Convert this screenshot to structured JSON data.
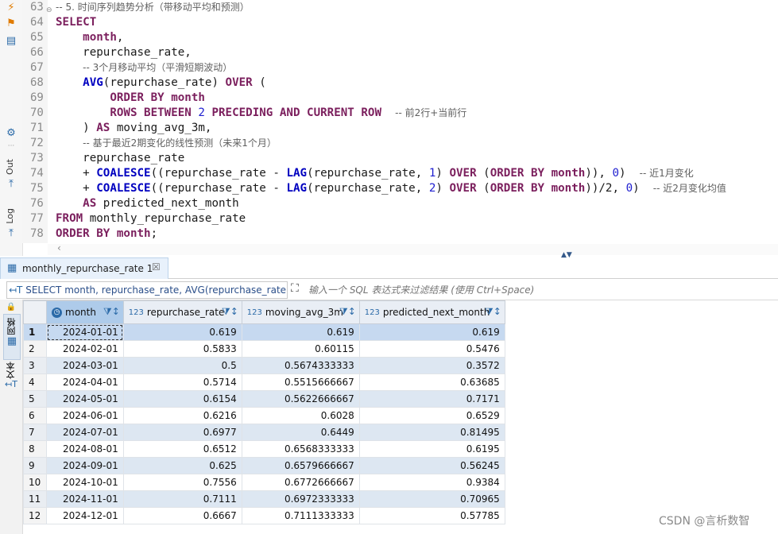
{
  "sidebar": {
    "out_label": "Out",
    "log_label": "Log",
    "grid_tab_label": "网格",
    "text_tab_label": "文本"
  },
  "editor": {
    "lines": [
      {
        "n": "63",
        "fold": "⊖",
        "tokens": [
          [
            "cm",
            "-- 5. 时间序列趋势分析（带移动平均和预测）"
          ]
        ]
      },
      {
        "n": "64",
        "tokens": [
          [
            "kw",
            "SELECT"
          ]
        ]
      },
      {
        "n": "65",
        "tokens": [
          [
            "tx",
            "    "
          ],
          [
            "kw",
            "month"
          ],
          [
            "tx",
            ","
          ]
        ]
      },
      {
        "n": "66",
        "tokens": [
          [
            "tx",
            "    repurchase_rate,"
          ]
        ]
      },
      {
        "n": "67",
        "tokens": [
          [
            "tx",
            "    "
          ],
          [
            "cm",
            "-- 3个月移动平均（平滑短期波动）"
          ]
        ]
      },
      {
        "n": "68",
        "tokens": [
          [
            "tx",
            "    "
          ],
          [
            "fn",
            "AVG"
          ],
          [
            "tx",
            "(repurchase_rate) "
          ],
          [
            "kw",
            "OVER"
          ],
          [
            "tx",
            " ("
          ]
        ]
      },
      {
        "n": "69",
        "tokens": [
          [
            "tx",
            "        "
          ],
          [
            "kw",
            "ORDER BY month"
          ]
        ]
      },
      {
        "n": "70",
        "tokens": [
          [
            "tx",
            "        "
          ],
          [
            "kw",
            "ROWS BETWEEN "
          ],
          [
            "num",
            "2"
          ],
          [
            "kw",
            " PRECEDING AND CURRENT ROW"
          ],
          [
            "tx",
            "  "
          ],
          [
            "cm",
            "-- 前2行+当前行"
          ]
        ]
      },
      {
        "n": "71",
        "tokens": [
          [
            "tx",
            "    ) "
          ],
          [
            "kw",
            "AS"
          ],
          [
            "tx",
            " moving_avg_3m,"
          ]
        ]
      },
      {
        "n": "72",
        "tokens": [
          [
            "tx",
            "    "
          ],
          [
            "cm",
            "-- 基于最近2期变化的线性预测（未来1个月）"
          ]
        ]
      },
      {
        "n": "73",
        "tokens": [
          [
            "tx",
            "    repurchase_rate"
          ]
        ]
      },
      {
        "n": "74",
        "tokens": [
          [
            "tx",
            "    + "
          ],
          [
            "fn",
            "COALESCE"
          ],
          [
            "tx",
            "((repurchase_rate - "
          ],
          [
            "fn",
            "LAG"
          ],
          [
            "tx",
            "(repurchase_rate, "
          ],
          [
            "num",
            "1"
          ],
          [
            "tx",
            ") "
          ],
          [
            "kw",
            "OVER"
          ],
          [
            "tx",
            " ("
          ],
          [
            "kw",
            "ORDER BY month"
          ],
          [
            "tx",
            ")), "
          ],
          [
            "num",
            "0"
          ],
          [
            "tx",
            ")  "
          ],
          [
            "cm",
            "-- 近1月变化"
          ]
        ]
      },
      {
        "n": "75",
        "tokens": [
          [
            "tx",
            "    + "
          ],
          [
            "fn",
            "COALESCE"
          ],
          [
            "tx",
            "((repurchase_rate - "
          ],
          [
            "fn",
            "LAG"
          ],
          [
            "tx",
            "(repurchase_rate, "
          ],
          [
            "num",
            "2"
          ],
          [
            "tx",
            ") "
          ],
          [
            "kw",
            "OVER"
          ],
          [
            "tx",
            " ("
          ],
          [
            "kw",
            "ORDER BY month"
          ],
          [
            "tx",
            "))/2, "
          ],
          [
            "num",
            "0"
          ],
          [
            "tx",
            ")  "
          ],
          [
            "cm",
            "-- 近2月变化均值"
          ]
        ]
      },
      {
        "n": "76",
        "tokens": [
          [
            "tx",
            "    "
          ],
          [
            "kw",
            "AS"
          ],
          [
            "tx",
            " predicted_next_month"
          ]
        ]
      },
      {
        "n": "77",
        "tokens": [
          [
            "kw",
            "FROM"
          ],
          [
            "tx",
            " monthly_repurchase_rate"
          ]
        ]
      },
      {
        "n": "78",
        "tokens": [
          [
            "kw",
            "ORDER BY month"
          ],
          [
            "tx",
            ";"
          ]
        ]
      }
    ]
  },
  "results": {
    "tab_label": "monthly_repurchase_rate 1",
    "sql_preview": "SELECT month, repurchase_rate, AVG(repurchase_rate) O",
    "filter_placeholder": "输入一个 SQL 表达式来过滤结果 (使用 Ctrl+Space)",
    "columns": [
      {
        "label": "month",
        "type": "date"
      },
      {
        "label": "repurchase_rate",
        "type": "123"
      },
      {
        "label": "moving_avg_3m",
        "type": "123"
      },
      {
        "label": "predicted_next_month",
        "type": "123"
      }
    ],
    "rows": [
      [
        "1",
        "2024-01-01",
        "0.619",
        "0.619",
        "0.619"
      ],
      [
        "2",
        "2024-02-01",
        "0.5833",
        "0.60115",
        "0.5476"
      ],
      [
        "3",
        "2024-03-01",
        "0.5",
        "0.5674333333",
        "0.3572"
      ],
      [
        "4",
        "2024-04-01",
        "0.5714",
        "0.5515666667",
        "0.63685"
      ],
      [
        "5",
        "2024-05-01",
        "0.6154",
        "0.5622666667",
        "0.7171"
      ],
      [
        "6",
        "2024-06-01",
        "0.6216",
        "0.6028",
        "0.6529"
      ],
      [
        "7",
        "2024-07-01",
        "0.6977",
        "0.6449",
        "0.81495"
      ],
      [
        "8",
        "2024-08-01",
        "0.6512",
        "0.6568333333",
        "0.6195"
      ],
      [
        "9",
        "2024-09-01",
        "0.625",
        "0.6579666667",
        "0.56245"
      ],
      [
        "10",
        "2024-10-01",
        "0.7556",
        "0.6772666667",
        "0.9384"
      ],
      [
        "11",
        "2024-11-01",
        "0.7111",
        "0.6972333333",
        "0.70965"
      ],
      [
        "12",
        "2024-12-01",
        "0.6667",
        "0.7111333333",
        "0.57785"
      ]
    ]
  },
  "watermark": "CSDN @言析数智"
}
